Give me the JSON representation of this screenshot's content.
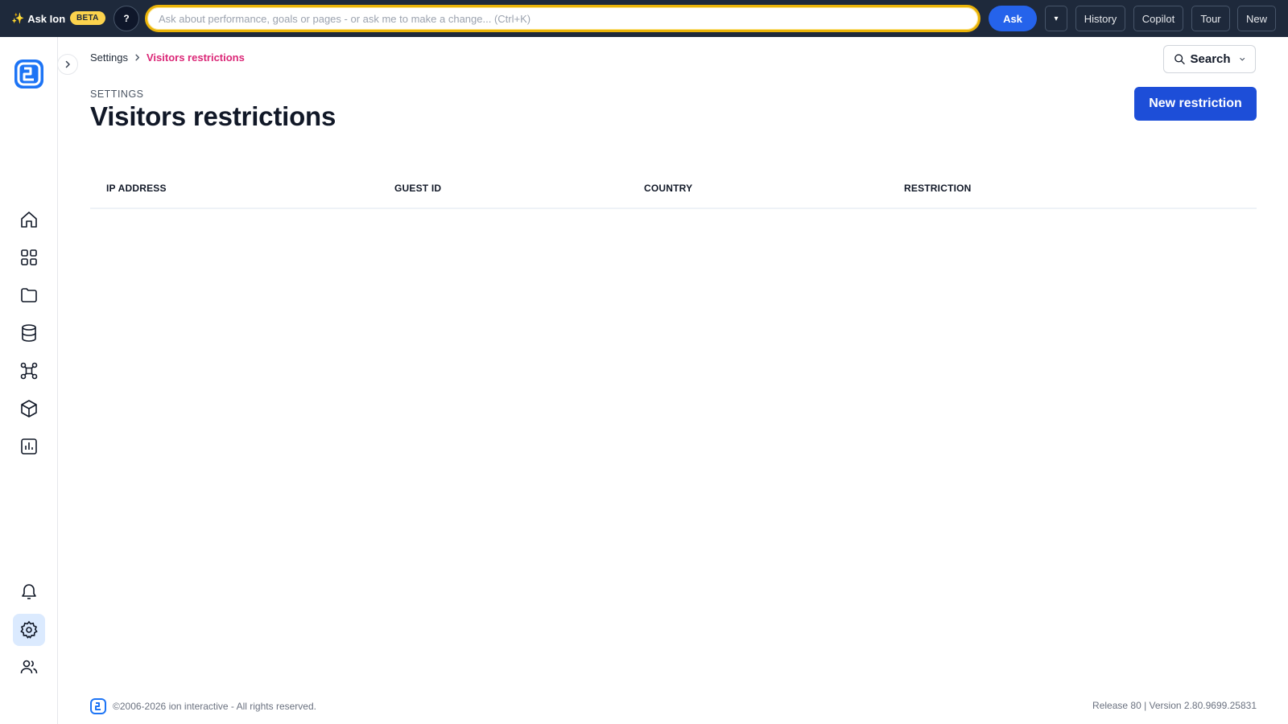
{
  "topbar": {
    "brand_label": "Ask Ion",
    "beta_badge": "BETA",
    "help_label": "?",
    "ask_placeholder": "Ask about performance, goals or pages - or ask me to make a change... (Ctrl+K)",
    "ask_button": "Ask",
    "dropdown_glyph": "▾",
    "buttons": {
      "history": "History",
      "copilot": "Copilot",
      "tour": "Tour",
      "new": "New"
    }
  },
  "sidebar": {
    "logo_icon": "ion-logo-icon",
    "items": [
      {
        "icon": "home-icon"
      },
      {
        "icon": "grid-icon"
      },
      {
        "icon": "folder-icon"
      },
      {
        "icon": "database-icon"
      },
      {
        "icon": "integrations-icon"
      },
      {
        "icon": "cube-icon"
      },
      {
        "icon": "report-chart-icon"
      }
    ],
    "bottom_items": [
      {
        "icon": "bell-icon"
      },
      {
        "icon": "gear-icon",
        "active": true
      },
      {
        "icon": "users-icon"
      }
    ]
  },
  "breadcrumb": {
    "parent": "Settings",
    "current": "Visitors restrictions"
  },
  "search": {
    "label": "Search"
  },
  "page": {
    "eyebrow": "SETTINGS",
    "title": "Visitors restrictions",
    "new_button": "New restriction"
  },
  "table": {
    "columns": [
      "IP ADDRESS",
      "GUEST ID",
      "COUNTRY",
      "RESTRICTION"
    ],
    "rows": []
  },
  "footer": {
    "copyright": "©2006-2026 ion interactive - All rights reserved.",
    "version": "Release 80 | Version 2.80.9699.25831"
  },
  "colors": {
    "topbar": "#1e293b",
    "accent": "#1d4ed8",
    "breadcrumb_current": "#db2777",
    "ask_border": "#eab308"
  }
}
